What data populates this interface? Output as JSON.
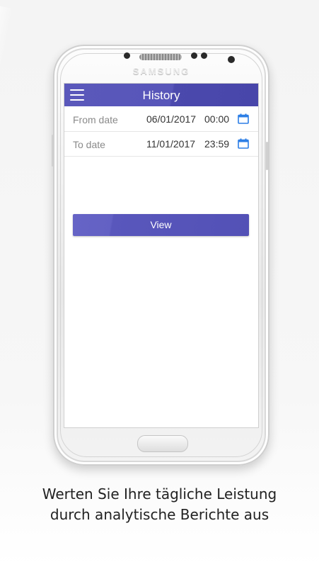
{
  "device": {
    "brand": "SAMSUNG"
  },
  "appbar": {
    "title": "History",
    "menu_icon": "hamburger-menu-icon"
  },
  "form": {
    "from": {
      "label": "From date",
      "date": "06/01/2017",
      "time": "00:00",
      "icon": "calendar-icon"
    },
    "to": {
      "label": "To date",
      "date": "11/01/2017",
      "time": "23:59",
      "icon": "calendar-icon"
    }
  },
  "actions": {
    "view_label": "View"
  },
  "caption": {
    "line1": "Werten Sie Ihre tägliche Leistung",
    "line2": "durch analytische Berichte aus"
  },
  "colors": {
    "primary": "#5856b9",
    "calendar_icon": "#2d7fe6"
  }
}
